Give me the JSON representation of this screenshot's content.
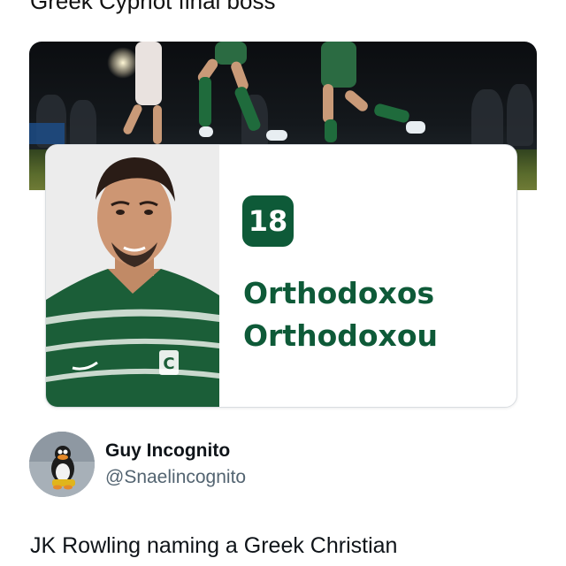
{
  "header": {
    "partial_text": "Greek Cypriot final boss"
  },
  "card": {
    "jersey_number": "18",
    "name_line1": "Orthodoxos",
    "name_line2": "Orthodoxou",
    "accent_color": "#0e5a38"
  },
  "author": {
    "display_name": "Guy Incognito",
    "handle": "@Snaelincognito"
  },
  "tweet": {
    "text": "JK Rowling naming a Greek Christian"
  }
}
